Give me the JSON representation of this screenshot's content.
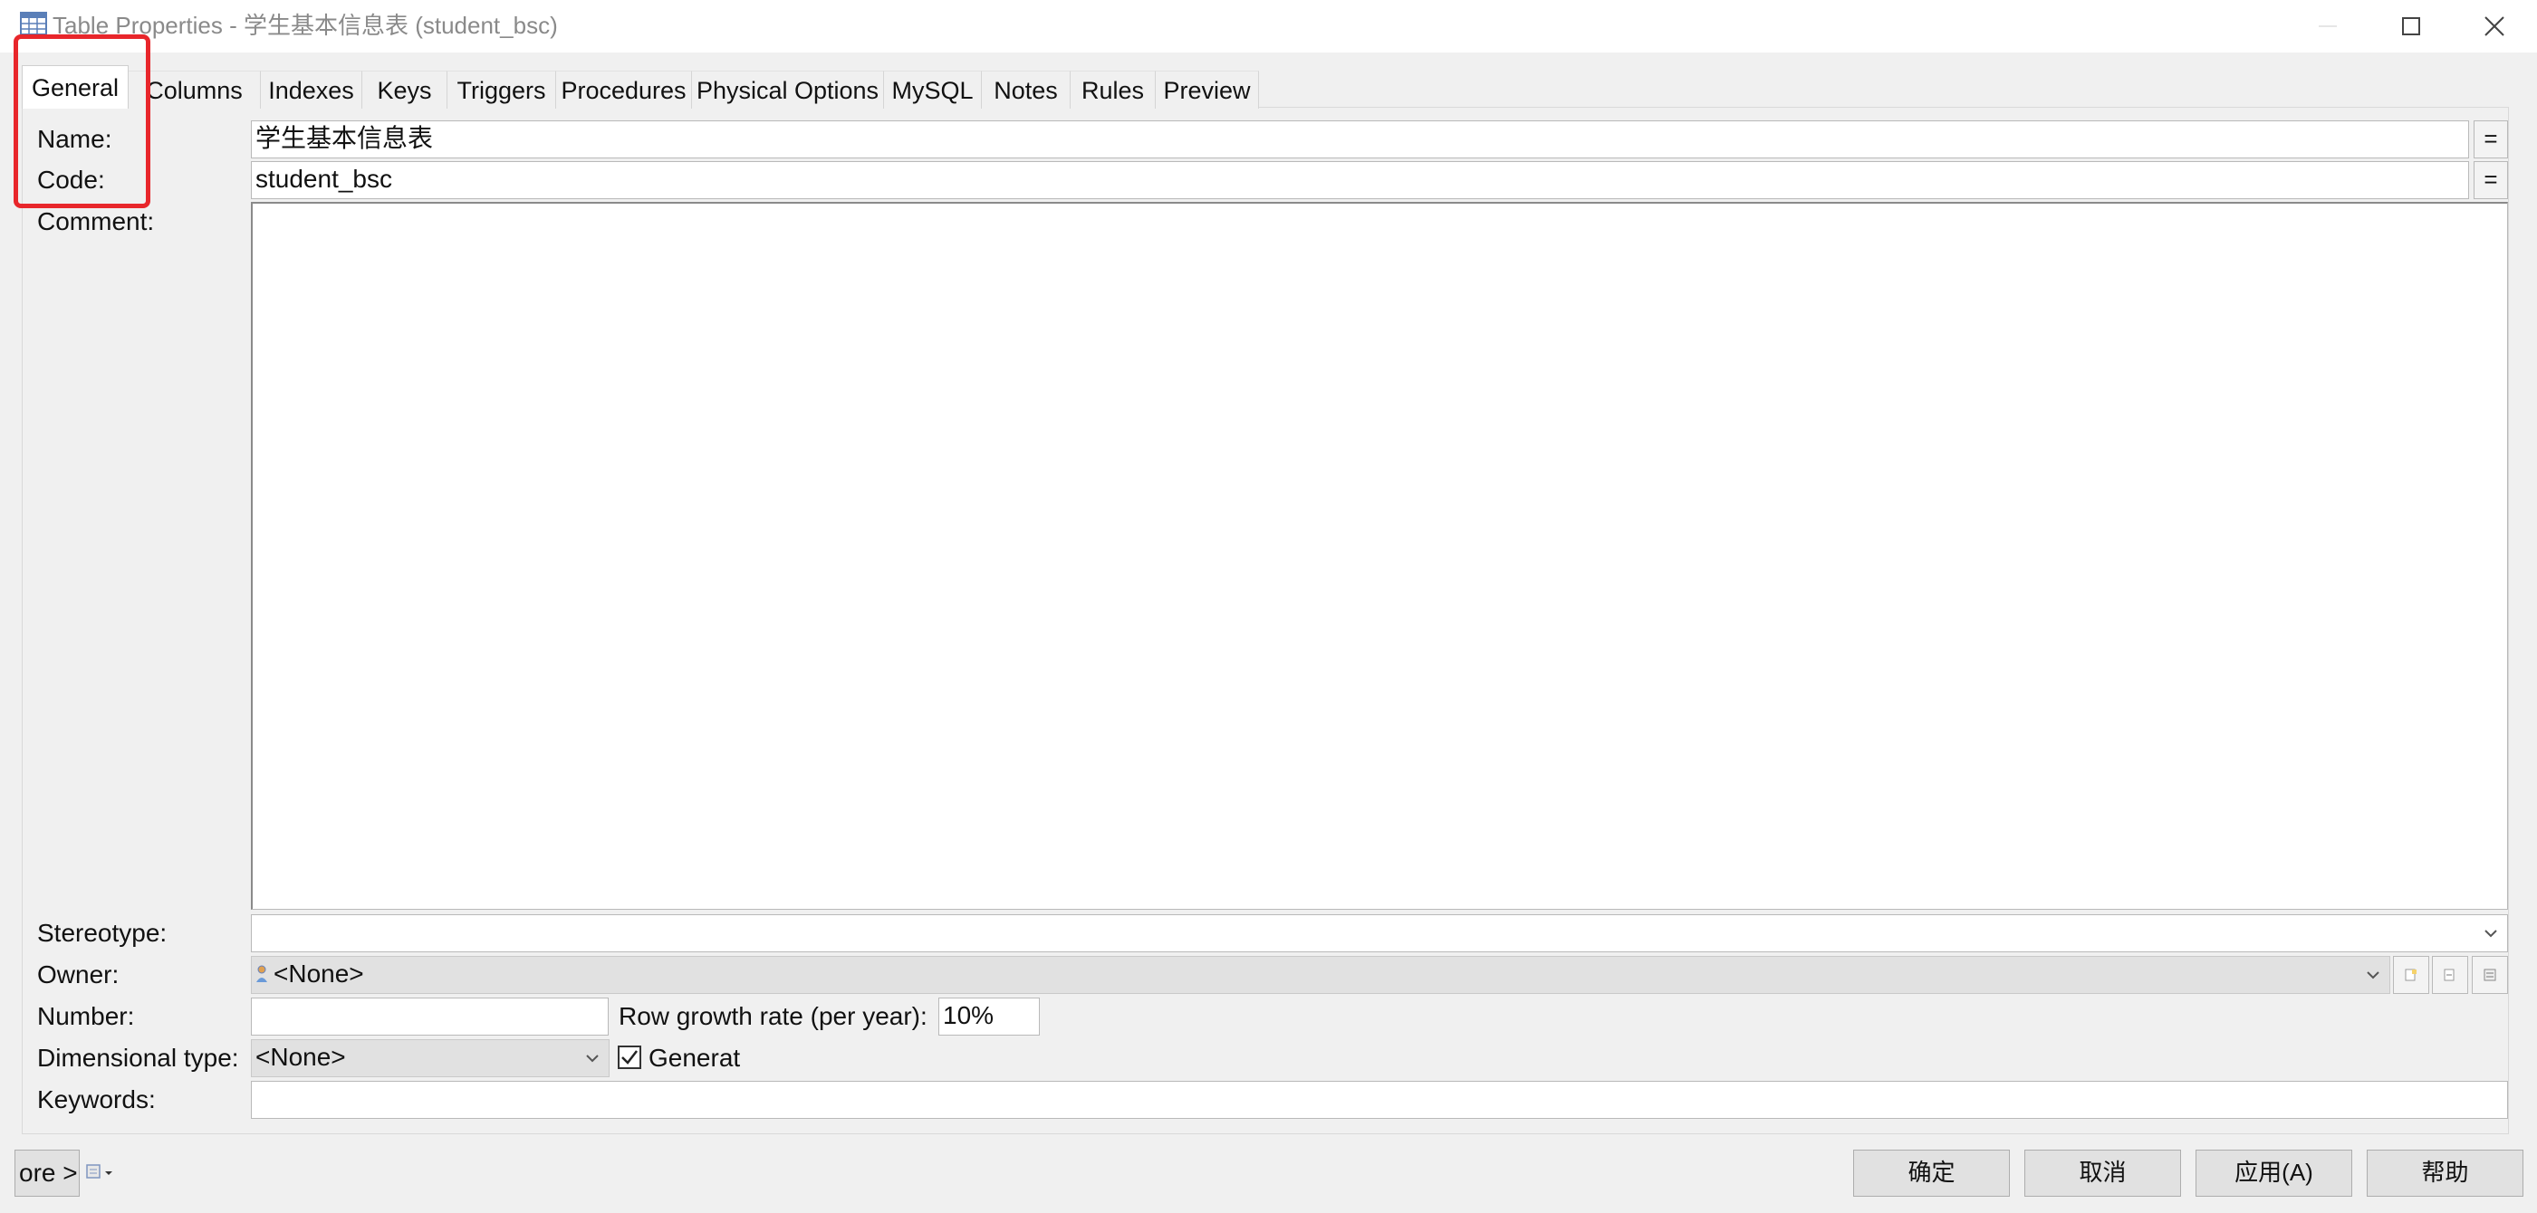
{
  "window": {
    "title": "Table Properties - 学生基本信息表 (student_bsc)",
    "icons": {
      "app": "table-icon",
      "minimize": "minimize-icon",
      "maximize": "maximize-icon",
      "close": "close-icon"
    }
  },
  "tabs": [
    {
      "label": "General",
      "active": true
    },
    {
      "label": "Columns"
    },
    {
      "label": "Indexes"
    },
    {
      "label": "Keys"
    },
    {
      "label": "Triggers"
    },
    {
      "label": "Procedures"
    },
    {
      "label": "Physical Options"
    },
    {
      "label": "MySQL"
    },
    {
      "label": "Notes"
    },
    {
      "label": "Rules"
    },
    {
      "label": "Preview"
    }
  ],
  "form": {
    "name_label": "Name:",
    "name_value": "学生基本信息表",
    "code_label": "Code:",
    "code_value": "student_bsc",
    "comment_label": "Comment:",
    "comment_value": "",
    "stereotype_label": "Stereotype:",
    "stereotype_value": "",
    "owner_label": "Owner:",
    "owner_value": "<None>",
    "number_label": "Number:",
    "number_value": "",
    "row_growth_label": "Row growth rate (per year):",
    "row_growth_value": "10%",
    "dimensional_label": "Dimensional type:",
    "dimensional_value": "<None>",
    "generate_label": "Generat",
    "generate_checked": true,
    "keywords_label": "Keywords:",
    "keywords_value": "",
    "eq_label": "="
  },
  "footer": {
    "more_label": "ore >",
    "ok": "确定",
    "cancel": "取消",
    "apply": "应用(A)",
    "help": "帮助"
  },
  "colors": {
    "highlight": "#e8262b",
    "dialog_bg": "#f0f0f0",
    "title_text": "#8a8a8a"
  }
}
